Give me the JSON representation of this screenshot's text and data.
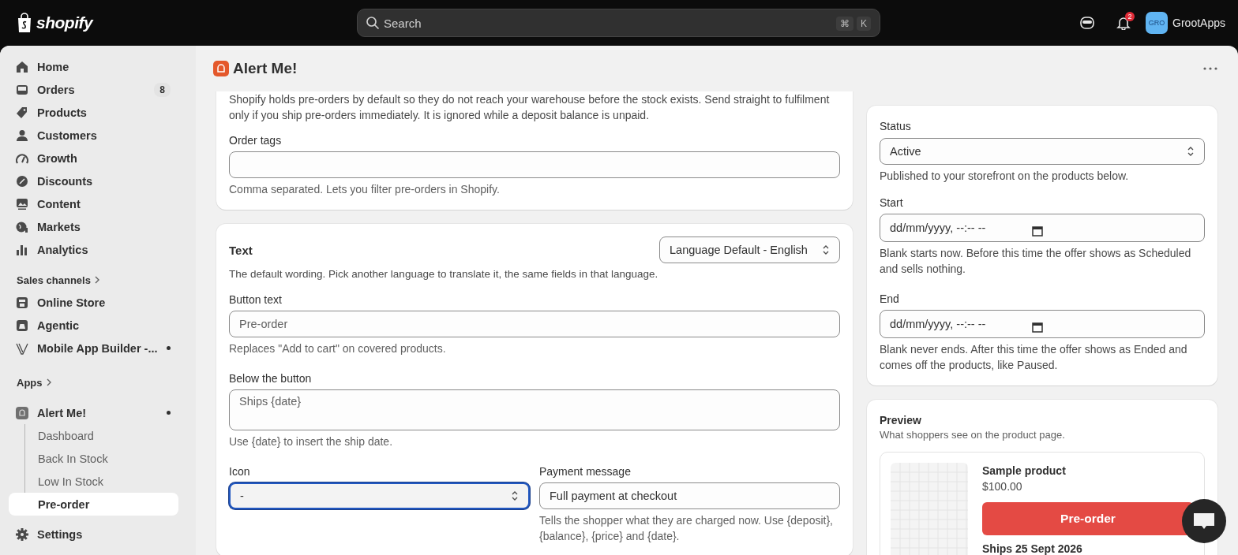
{
  "topbar": {
    "brand": "shopify",
    "search": {
      "placeholder": "Search",
      "shortcut": [
        "⌘",
        "K"
      ]
    },
    "notifications": {
      "count": "2"
    },
    "account": {
      "initials": "GRO",
      "name": "GrootApps"
    }
  },
  "sidebar": {
    "sections": [
      {
        "items": [
          {
            "label": "Home",
            "selected": false
          },
          {
            "label": "Orders",
            "badge": "8",
            "selected": false
          },
          {
            "label": "Products",
            "selected": false
          },
          {
            "label": "Customers",
            "selected": false
          },
          {
            "label": "Growth",
            "selected": false
          },
          {
            "label": "Discounts",
            "selected": false
          },
          {
            "label": "Content",
            "selected": false
          },
          {
            "label": "Markets",
            "selected": false
          },
          {
            "label": "Analytics",
            "selected": false
          }
        ]
      },
      {
        "heading": "Sales channels",
        "items": [
          {
            "label": "Online Store",
            "selected": false
          },
          {
            "label": "Agentic",
            "selected": false
          },
          {
            "label": "Mobile App Builder -...",
            "dot": true,
            "selected": false
          }
        ]
      },
      {
        "heading": "Apps",
        "items": [
          {
            "label": "Alert Me!",
            "dot": true,
            "selected": false,
            "children": [
              {
                "label": "Dashboard",
                "selected": false
              },
              {
                "label": "Back In Stock",
                "selected": false
              },
              {
                "label": "Low In Stock",
                "selected": false
              },
              {
                "label": "Pre-order",
                "selected": true
              }
            ]
          }
        ]
      }
    ],
    "footer": {
      "label": "Settings",
      "selected": false
    }
  },
  "page": {
    "title": "Alert Me!"
  },
  "left_cards": [
    {
      "description": "Shopify holds pre-orders by default so they do not reach your warehouse before the stock exists. Send straight to fulfilment only if you ship pre-orders immediately. It is ignored while a deposit balance is unpaid.",
      "fields": [
        {
          "kind": "text",
          "label": "Order tags",
          "help": "Comma separated. Lets you filter pre-orders in Shopify."
        }
      ]
    },
    {
      "title": "Text",
      "language": {
        "value": "Language Default - English"
      },
      "description": "The default wording. Pick another language to translate it, the same fields in that language.",
      "fields": [
        {
          "kind": "text",
          "label": "Button text",
          "placeholder": "Pre-order",
          "help": "Replaces \"Add to cart\" on covered products."
        },
        {
          "kind": "textarea",
          "label": "Below the button",
          "placeholder": "Ships {date}",
          "help": "Use {date} to insert the ship date."
        }
      ],
      "row": [
        {
          "kind": "select",
          "label": "Icon",
          "value": "-",
          "focused": true
        },
        {
          "kind": "text",
          "label": "Payment message",
          "value": "Full payment at checkout",
          "help": "Tells the shopper what they are charged now. Use {deposit}, {balance}, {price} and {date}."
        }
      ]
    }
  ],
  "status_card": {
    "fields": [
      {
        "kind": "select",
        "label": "Status",
        "value": "Active",
        "help": "Published to your storefront on the products below."
      },
      {
        "kind": "date",
        "label": "Start",
        "placeholder": "dd/mm/yyyy, --:-- --",
        "help": "Blank starts now. Before this time the offer shows as Scheduled and sells nothing."
      },
      {
        "kind": "date",
        "label": "End",
        "placeholder": "dd/mm/yyyy, --:-- --",
        "help": "Blank never ends. After this time the offer shows as Ended and comes off the products, like Paused."
      }
    ]
  },
  "preview": {
    "title": "Preview",
    "subtitle": "What shoppers see on the product page.",
    "product": {
      "name": "Sample product",
      "price": "$100.00",
      "button": "Pre-order",
      "note": "Ships 25 Sept 2026"
    }
  }
}
